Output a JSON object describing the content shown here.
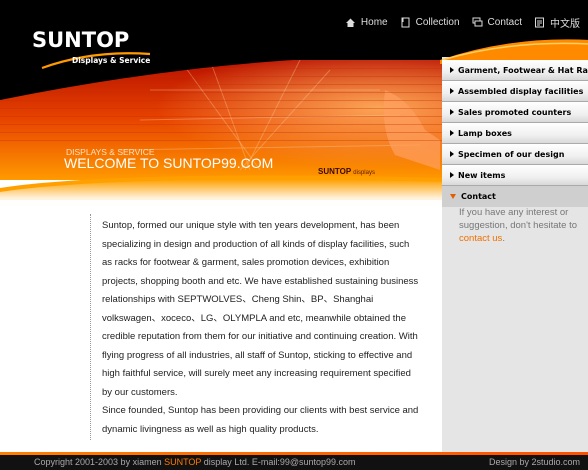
{
  "brand": {
    "logo_text": "SUNTOP",
    "tagline": "Displays & Service"
  },
  "topnav": [
    {
      "label": "Home",
      "icon": "home-icon"
    },
    {
      "label": "Collection",
      "icon": "bookmark-icon"
    },
    {
      "label": "Contact",
      "icon": "chat-icon"
    },
    {
      "label": "中文版",
      "icon": "document-icon"
    }
  ],
  "hero": {
    "subtitle": "DISPLAYS & SERVICE",
    "title": "WELCOME TO SUNTOP99.COM",
    "brand_main": "SUNTOP",
    "brand_small": "displays"
  },
  "content": {
    "paragraph1": "Suntop, formed our unique style with ten years development, has been specializing in design and production of all kinds of display facilities, such as racks for footwear & garment, sales promotion devices, exhibition projects, shopping booth and etc.  We have established sustaining business relationships with SEPTWOLVES、Cheng Shin、BP、Shanghai volkswagen、xoceco、LG、OLYMPLA and etc, meanwhile obtained the credible reputation from them for our initiative and continuing creation.  With flying progress of all industries, all staff of Suntop, sticking to effective and high faithful service, will surely meet any increasing requirement specified by our customers.",
    "paragraph2": "Since founded, Suntop has been providing our clients with best service and dynamic livingness as well as high quality products."
  },
  "sidebar": {
    "items": [
      {
        "label": "Garment, Footwear & Hat Rack"
      },
      {
        "label": "Assembled display facilities"
      },
      {
        "label": "Sales promoted counters"
      },
      {
        "label": "Lamp boxes"
      },
      {
        "label": "Specimen of our design"
      },
      {
        "label": "New items"
      }
    ],
    "active": {
      "label": "Contact"
    },
    "contact_text": "If you have any interest or suggestion, don't hesitate to",
    "contact_link": "contact us",
    "contact_end": "."
  },
  "footer": {
    "copyright_pre": "Copyright 2001-2003 by xiamen",
    "copyright_brand": "SUNTOP",
    "copyright_post": "display Ltd.  E-mail:99@suntop99.com",
    "credit": "Design by 2studio.com"
  },
  "colors": {
    "accent": "#ff7a00",
    "dark": "#000000",
    "sidebar_bg": "#e5e5e5"
  }
}
